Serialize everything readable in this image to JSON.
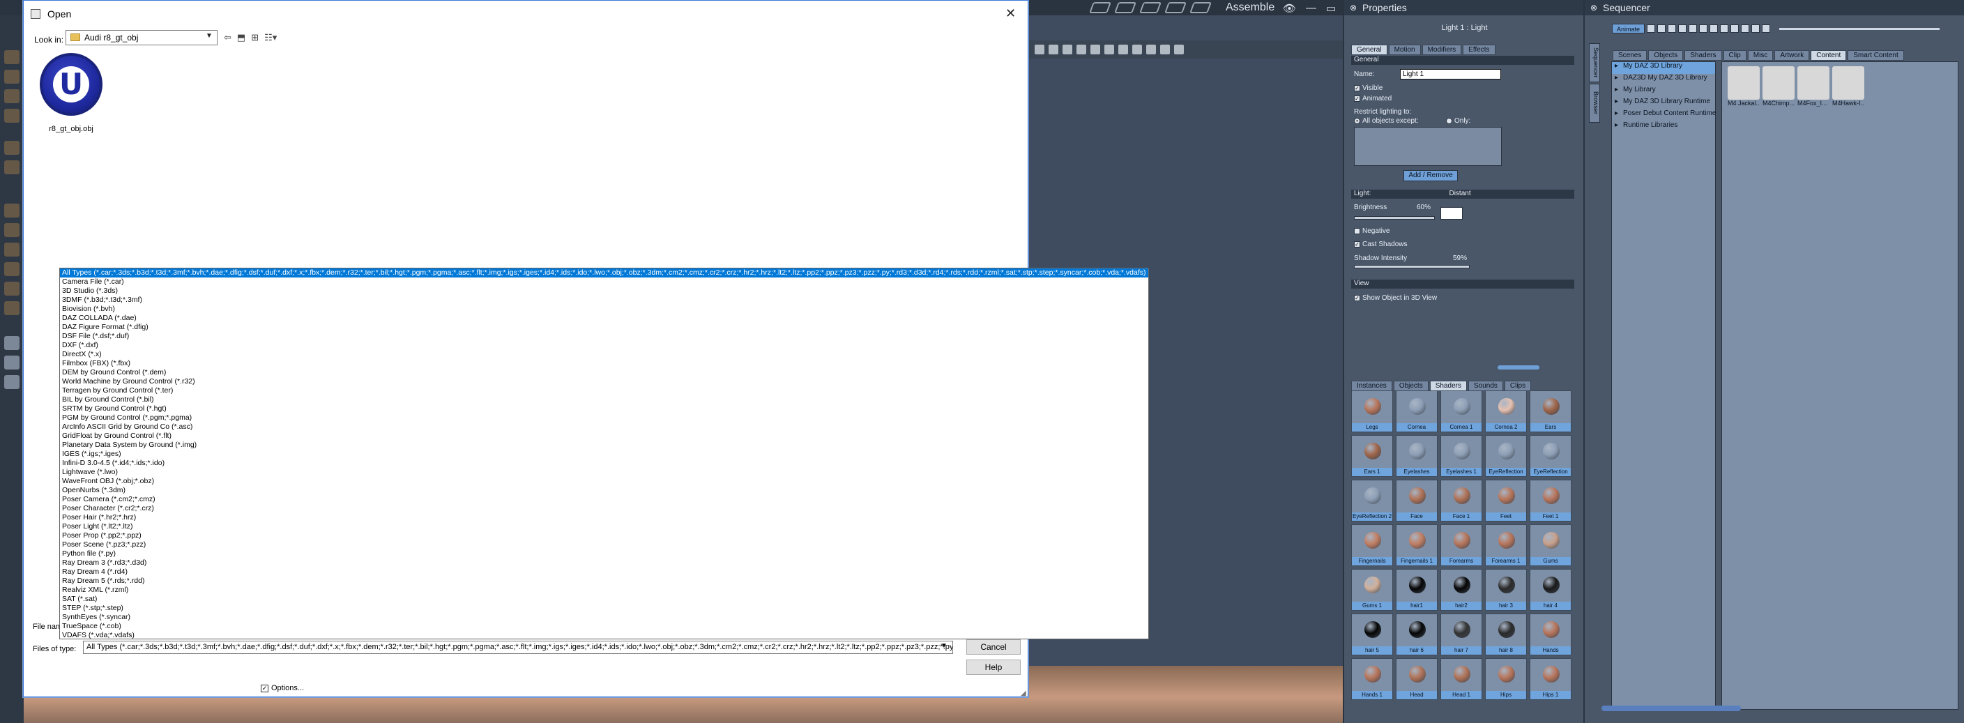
{
  "app": {
    "mode_label": "Assemble",
    "window_buttons": [
      "👁",
      "—",
      "▭",
      "✕"
    ]
  },
  "properties": {
    "title": "Properties",
    "header": "Light 1 : Light",
    "tabs": [
      "General",
      "Motion",
      "Modifiers",
      "Effects"
    ],
    "general_section": "General",
    "name_label": "Name:",
    "name_value": "Light 1",
    "visible_label": "Visible",
    "animated_label": "Animated",
    "restrict_label": "Restrict lighting to:",
    "all_except_label": "All objects except:",
    "only_label": "Only:",
    "add_remove_label": "Add / Remove",
    "light_section": "Light:",
    "light_type": "Distant",
    "brightness_label": "Brightness",
    "brightness_value": "60%",
    "negative_label": "Negative",
    "cast_shadows_label": "Cast Shadows",
    "shadow_intensity_label": "Shadow Intensity",
    "shadow_intensity_value": "59%",
    "view_section": "View",
    "show_in_3d_label": "Show Object in 3D View",
    "lower_tabs": [
      "Instances",
      "Objects",
      "Shaders",
      "Sounds",
      "Clips"
    ],
    "shaders": [
      {
        "label": "Legs",
        "color": "#b8755a"
      },
      {
        "label": "Cornea",
        "color": "#8e9fb6"
      },
      {
        "label": "Cornea 1",
        "color": "#8e9fb6"
      },
      {
        "label": "Cornea 2",
        "color": "#e6c0b0"
      },
      {
        "label": "Ears",
        "color": "#a06548"
      },
      {
        "label": "Ears 1",
        "color": "#a06548"
      },
      {
        "label": "Eyelashes",
        "color": "#8e9fb6"
      },
      {
        "label": "Eyelashes 1",
        "color": "#8e9fb6"
      },
      {
        "label": "EyeReflection",
        "color": "#8e9fb6"
      },
      {
        "label": "EyeReflection",
        "color": "#8e9fb6"
      },
      {
        "label": "EyeReflection 2",
        "color": "#8e9fb6"
      },
      {
        "label": "Face",
        "color": "#b07256"
      },
      {
        "label": "Face 1",
        "color": "#b07256"
      },
      {
        "label": "Feet",
        "color": "#b8755a"
      },
      {
        "label": "Feet 1",
        "color": "#b8755a"
      },
      {
        "label": "Fingernails",
        "color": "#c27e62"
      },
      {
        "label": "Fingernails 1",
        "color": "#c27e62"
      },
      {
        "label": "Forearms",
        "color": "#b8755a"
      },
      {
        "label": "Forearms 1",
        "color": "#b8755a"
      },
      {
        "label": "Gums",
        "color": "#c8a08a"
      },
      {
        "label": "Gums 1",
        "color": "#d2b09a"
      },
      {
        "label": "hair1",
        "color": "#050505"
      },
      {
        "label": "hair2",
        "color": "#050505"
      },
      {
        "label": "hair 3",
        "color": "#2a2a2a"
      },
      {
        "label": "hair 4",
        "color": "#1a1a1a"
      },
      {
        "label": "hair 5",
        "color": "#050505"
      },
      {
        "label": "hair 6",
        "color": "#050505"
      },
      {
        "label": "hair 7",
        "color": "#333333"
      },
      {
        "label": "hair 8",
        "color": "#2a2a2a"
      },
      {
        "label": "Hands",
        "color": "#b8755a"
      },
      {
        "label": "Hands 1",
        "color": "#b8755a"
      },
      {
        "label": "Head",
        "color": "#b07256"
      },
      {
        "label": "Head 1",
        "color": "#b07256"
      },
      {
        "label": "Hips",
        "color": "#b8755a"
      },
      {
        "label": "Hips 1",
        "color": "#b8755a"
      }
    ]
  },
  "sequencer": {
    "title": "Sequencer",
    "animate_label": "Animate",
    "tabs": [
      "Scenes",
      "Objects",
      "Shaders",
      "Clip",
      "Misc",
      "Artwork",
      "Content",
      "Smart Content"
    ],
    "side_tabs": [
      "Sequencer",
      "Browser"
    ],
    "library": [
      "My DAZ 3D Library",
      "DAZ3D My DAZ 3D Library",
      "My Library",
      "My DAZ 3D Library Runtime",
      "Poser Debut Content Runtime",
      "Runtime Libraries"
    ],
    "thumbs": [
      "M4 Jackal...",
      "M4Chimp...",
      "M4Fox_I...",
      "M4Hawk-I..."
    ]
  },
  "dialog": {
    "title": "Open",
    "look_in_label": "Look in:",
    "look_in_value": "Audi r8_gt_obj",
    "file": {
      "name": "r8_gt_obj.obj",
      "icon_letter": "U"
    },
    "file_name_label": "File name:",
    "files_of_type_label": "Files of type:",
    "files_of_type_value": "All Types (*.car;*.3ds;*.b3d;*.t3d;*.3mf;*.bvh;*.dae;*.dfig;*.dsf;*.duf;*.dxf;*.x;*.fbx;*.dem;*.r32;*.ter;*.bil;*.hgt;*.pgm;*.pgma;*.asc;*.flt;*.img;*.igs;*.iges;*.id4;*.ids;*.ido;*.lwo;*.obj;*.obz;*.3dm;*.cm2;*.cmz;*.cr2;*.crz;*.hr2;*.hrz;*.lt2;*.ltz;*.pp2;*.ppz;*.pz3;*.pzz;*.py;*.rd3;*",
    "cancel_label": "Cancel",
    "help_label": "Help",
    "options_label": "Options...",
    "file_types": [
      "All Types (*.car;*.3ds;*.b3d;*.t3d;*.3mf;*.bvh;*.dae;*.dfig;*.dsf;*.duf;*.dxf;*.x;*.fbx;*.dem;*.r32;*.ter;*.bil;*.hgt;*.pgm;*.pgma;*.asc;*.flt;*.img;*.igs;*.iges;*.id4;*.ids;*.ido;*.lwo;*.obj;*.obz;*.3dm;*.cm2;*.cmz;*.cr2;*.crz;*.hr2;*.hrz;*.lt2;*.ltz;*.pp2;*.ppz;*.pz3;*.pzz;*.py;*.rd3;*.d3d;*.rd4;*.rds;*.rdd;*.rzml;*.sat;*.stp;*.step;*.syncar;*.cob;*.vda;*.vdafs)",
      "Camera File (*.car)",
      "3D Studio (*.3ds)",
      "3DMF (*.b3d;*.t3d;*.3mf)",
      "Biovision (*.bvh)",
      "DAZ COLLADA (*.dae)",
      "DAZ Figure Format (*.dfig)",
      "DSF File (*.dsf;*.duf)",
      "DXF (*.dxf)",
      "DirectX (*.x)",
      "Filmbox (FBX) (*.fbx)",
      "DEM by Ground Control (*.dem)",
      "World Machine by Ground Control (*.r32)",
      "Terragen by Ground Control (*.ter)",
      "BIL by Ground Control (*.bil)",
      "SRTM by Ground Control (*.hgt)",
      "PGM by Ground Control (*.pgm;*.pgma)",
      "ArcInfo ASCII Grid by Ground Co (*.asc)",
      "GridFloat by Ground Control (*.flt)",
      "Planetary Data System by Ground (*.img)",
      "IGES (*.igs;*.iges)",
      "Infini-D 3.0-4.5 (*.id4;*.ids;*.ido)",
      "Lightwave (*.lwo)",
      "WaveFront OBJ (*.obj;*.obz)",
      "OpenNurbs (*.3dm)",
      "Poser Camera (*.cm2;*.cmz)",
      "Poser Character (*.cr2;*.crz)",
      "Poser Hair (*.hr2;*.hrz)",
      "Poser Light (*.lt2;*.ltz)",
      "Poser Prop (*.pp2;*.ppz)",
      "Poser Scene (*.pz3;*.pzz)",
      "Python file (*.py)",
      "Ray Dream 3 (*.rd3;*.d3d)",
      "Ray Dream 4 (*.rd4)",
      "Ray Dream 5 (*.rds;*.rdd)",
      "Realviz XML (*.rzml)",
      "SAT (*.sat)",
      "STEP (*.stp;*.step)",
      "SynthEyes (*.syncar)",
      "TrueSpace (*.cob)",
      "VDAFS (*.vda;*.vdafs)"
    ]
  }
}
